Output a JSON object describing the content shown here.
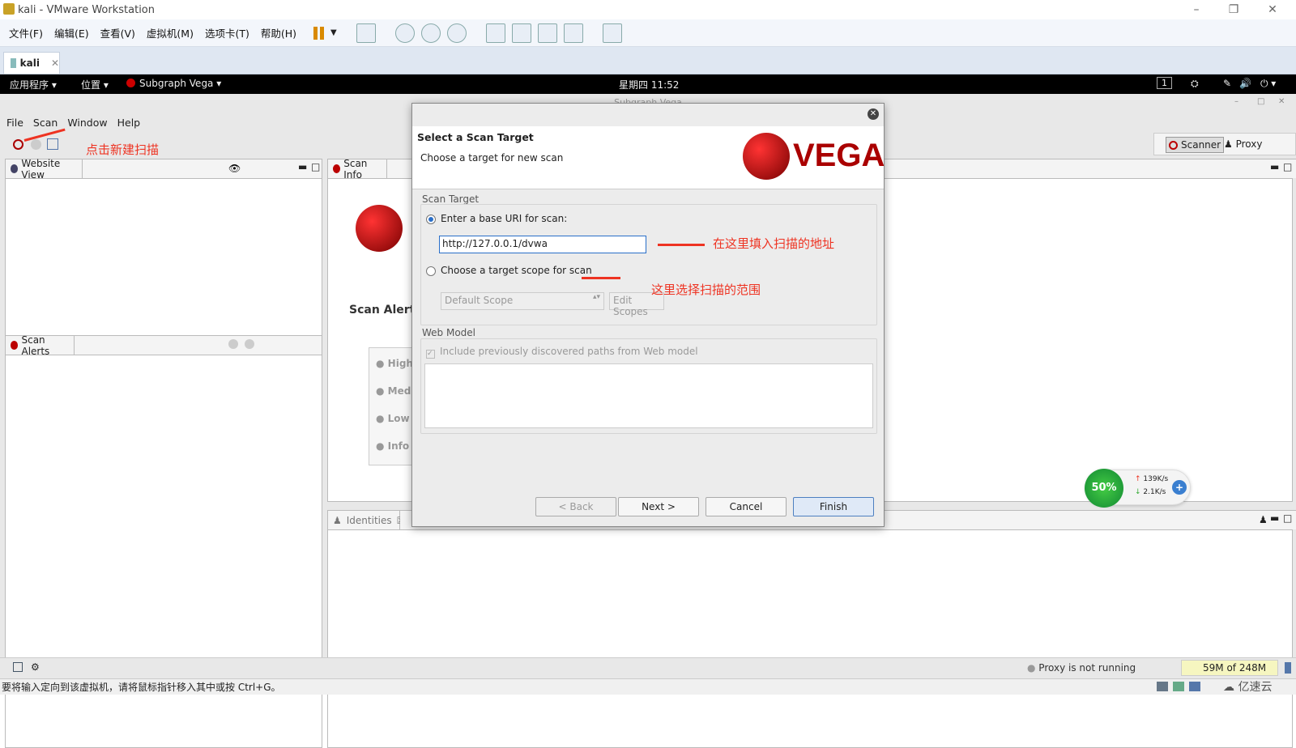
{
  "vmware": {
    "title": "kali - VMware Workstation",
    "menu": [
      "文件(F)",
      "编辑(E)",
      "查看(V)",
      "虚拟机(M)",
      "选项卡(T)",
      "帮助(H)"
    ],
    "tab": "kali",
    "status_hint": "要将输入定向到该虚拟机，请将鼠标指针移入其中或按 Ctrl+G。",
    "watermark": "亿速云"
  },
  "kali": {
    "apps": "应用程序",
    "places": "位置",
    "app": "Subgraph Vega",
    "clock": "星期四 11:52",
    "workspace": "1"
  },
  "vega": {
    "window_title": "Subgraph Vega",
    "menu": [
      "File",
      "Scan",
      "Window",
      "Help"
    ],
    "perspectives": {
      "scanner": "Scanner",
      "proxy": "Proxy"
    },
    "website_view": "Website View",
    "scan_alerts": "Scan Alerts",
    "scan_info": "Scan Info",
    "identities": "Identities",
    "scan_alerts_heading": "Scan Alert",
    "severity": [
      "High",
      "Med",
      "Low",
      "Info"
    ],
    "proxy_status": "Proxy is not running",
    "memory": "59M of 248M"
  },
  "dialog": {
    "heading": "Select a Scan Target",
    "subheading": "Choose a target for new scan",
    "logo": "VEGA",
    "scan_target_label": "Scan Target",
    "option_uri": "Enter a base URI for scan:",
    "uri_value": "http://127.0.0.1/dvwa",
    "option_scope": "Choose a target scope for scan",
    "scope_value": "Default Scope",
    "edit_scopes": "Edit Scopes",
    "web_model_label": "Web Model",
    "include_paths": "Include previously discovered paths from Web model",
    "buttons": {
      "back": "< Back",
      "next": "Next >",
      "cancel": "Cancel",
      "finish": "Finish"
    }
  },
  "annotations": {
    "new_scan": "点击新建扫描",
    "fill_address": "在这里填入扫描的地址",
    "choose_scope": "这里选择扫描的范围"
  },
  "netmon": {
    "percent": "50%",
    "up": "139K/s",
    "down": "2.1K/s"
  },
  "colors": {
    "accent": "#2a6fc9",
    "vega_red": "#b00000",
    "annotation": "#ee3322"
  }
}
